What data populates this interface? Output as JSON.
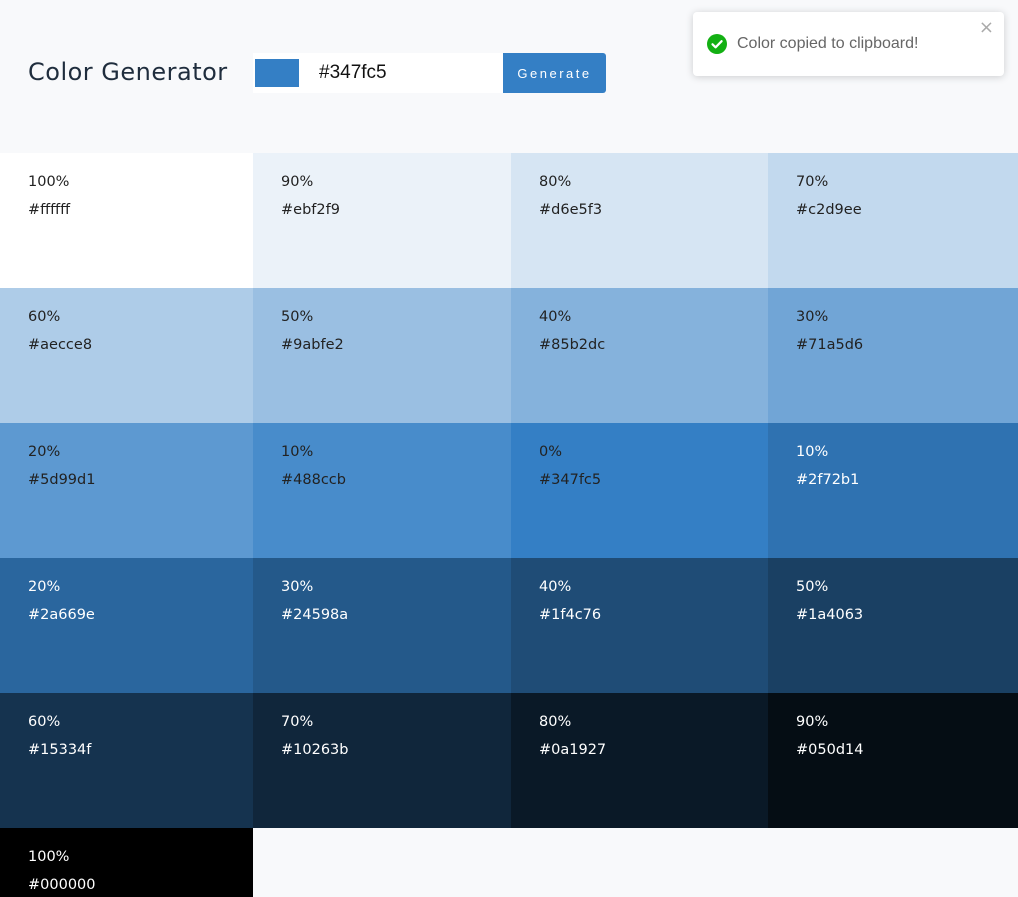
{
  "header": {
    "title": "Color Generator",
    "input_value": "#347fc5",
    "swatch_color": "#347fc5",
    "generate_label": "Generate"
  },
  "toast": {
    "message": "Color copied to clipboard!",
    "close_symbol": "×",
    "icon": "check-circle-icon",
    "icon_color": "#13b013"
  },
  "shades": [
    {
      "percent": "100%",
      "hex": "#ffffff",
      "color": "#ffffff",
      "text": "#222222"
    },
    {
      "percent": "90%",
      "hex": "#ebf2f9",
      "color": "#ebf2f9",
      "text": "#222222"
    },
    {
      "percent": "80%",
      "hex": "#d6e5f3",
      "color": "#d6e5f3",
      "text": "#222222"
    },
    {
      "percent": "70%",
      "hex": "#c2d9ee",
      "color": "#c2d9ee",
      "text": "#222222"
    },
    {
      "percent": "60%",
      "hex": "#aecce8",
      "color": "#aecce8",
      "text": "#222222"
    },
    {
      "percent": "50%",
      "hex": "#9abfe2",
      "color": "#9abfe2",
      "text": "#222222"
    },
    {
      "percent": "40%",
      "hex": "#85b2dc",
      "color": "#85b2dc",
      "text": "#222222"
    },
    {
      "percent": "30%",
      "hex": "#71a5d6",
      "color": "#71a5d6",
      "text": "#222222"
    },
    {
      "percent": "20%",
      "hex": "#5d99d1",
      "color": "#5d99d1",
      "text": "#222222"
    },
    {
      "percent": "10%",
      "hex": "#488ccb",
      "color": "#488ccb",
      "text": "#222222"
    },
    {
      "percent": "0%",
      "hex": "#347fc5",
      "color": "#347fc5",
      "text": "#222222"
    },
    {
      "percent": "10%",
      "hex": "#2f72b1",
      "color": "#2f72b1",
      "text": "#ffffff"
    },
    {
      "percent": "20%",
      "hex": "#2a669e",
      "color": "#2a669e",
      "text": "#ffffff"
    },
    {
      "percent": "30%",
      "hex": "#24598a",
      "color": "#24598a",
      "text": "#ffffff"
    },
    {
      "percent": "40%",
      "hex": "#1f4c76",
      "color": "#1f4c76",
      "text": "#ffffff"
    },
    {
      "percent": "50%",
      "hex": "#1a4063",
      "color": "#1a4063",
      "text": "#ffffff"
    },
    {
      "percent": "60%",
      "hex": "#15334f",
      "color": "#15334f",
      "text": "#ffffff"
    },
    {
      "percent": "70%",
      "hex": "#10263b",
      "color": "#10263b",
      "text": "#ffffff"
    },
    {
      "percent": "80%",
      "hex": "#0a1927",
      "color": "#0a1927",
      "text": "#ffffff"
    },
    {
      "percent": "90%",
      "hex": "#050d14",
      "color": "#050d14",
      "text": "#ffffff"
    },
    {
      "percent": "100%",
      "hex": "#000000",
      "color": "#000000",
      "text": "#ffffff"
    }
  ]
}
